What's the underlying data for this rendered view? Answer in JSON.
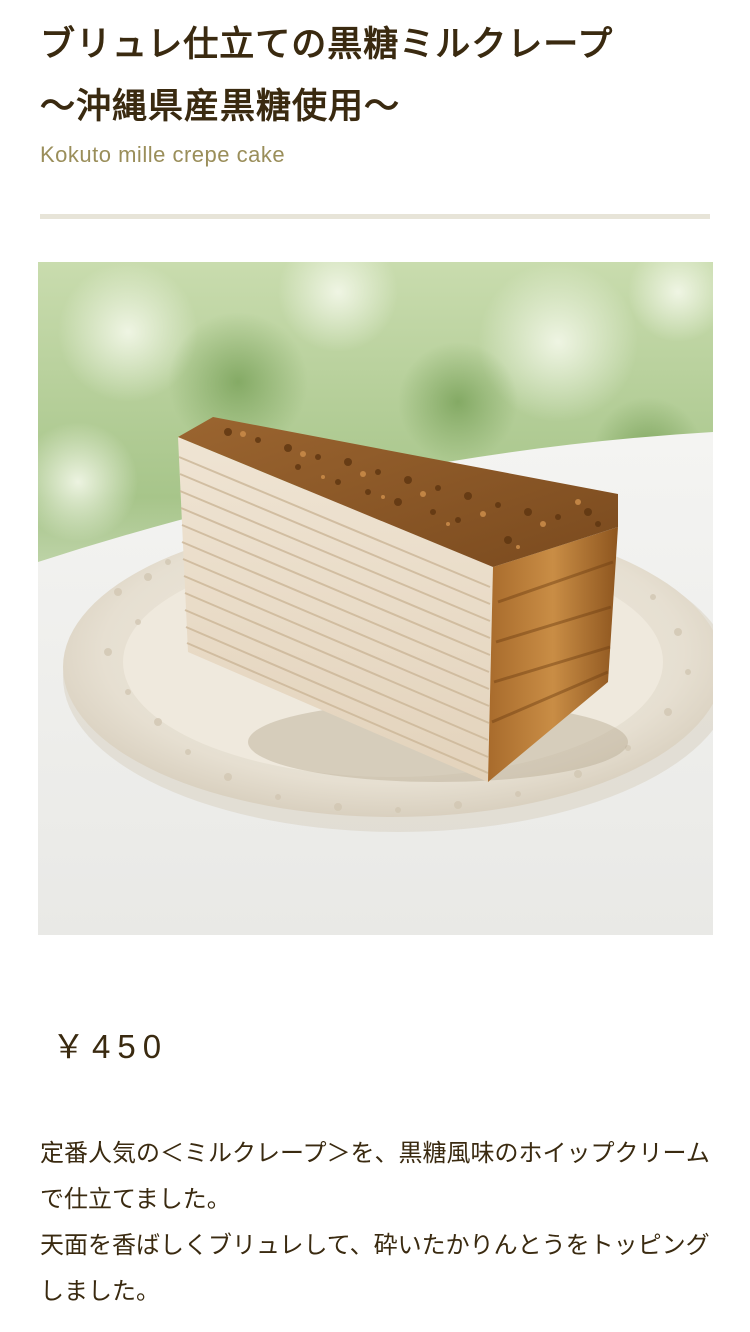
{
  "product": {
    "title_line1": "ブリュレ仕立ての黒糖ミルクレープ",
    "title_line2": "〜沖縄県産黒糖使用〜",
    "subtitle": "Kokuto mille crepe cake",
    "image_alt": "cake-photo",
    "price": "￥450",
    "description": [
      "定番人気の＜ミルクレープ＞を、黒糖風味のホイップクリームで仕立てました。",
      "天面を香ばしくブリュレして、砕いたかりんとうをトッピングしました。"
    ]
  },
  "colors": {
    "title": "#3a2a10",
    "subtitle": "#9a8e5a",
    "divider": "#e7e4d8",
    "text": "#3a2a10"
  }
}
